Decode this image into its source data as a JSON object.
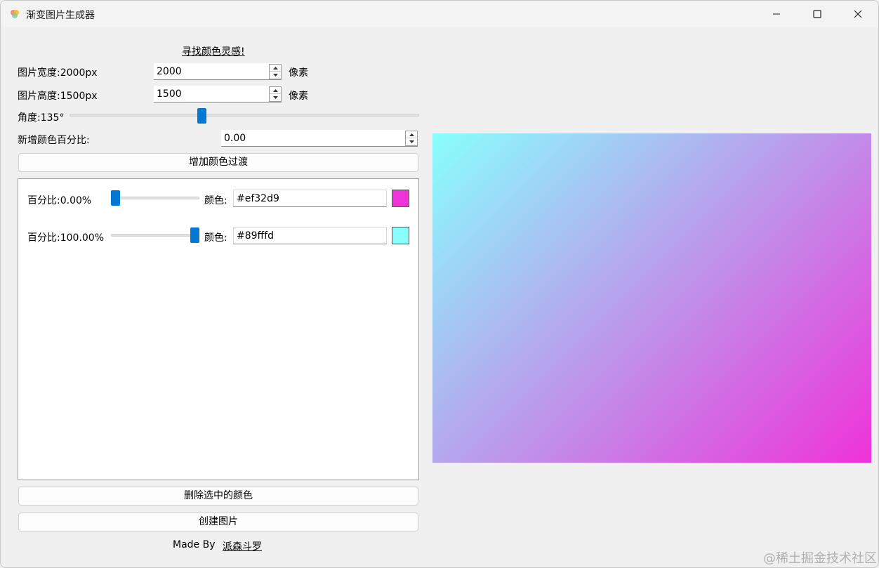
{
  "window": {
    "title": "渐变图片生成器"
  },
  "inspiration_link": "寻找颜色灵感!",
  "width": {
    "label": "图片宽度:2000px",
    "value": "2000",
    "unit": "像素"
  },
  "height": {
    "label": "图片高度:1500px",
    "value": "1500",
    "unit": "像素"
  },
  "angle": {
    "label": "角度:135°",
    "value_degrees": 135,
    "min": 0,
    "max": 360
  },
  "new_color_percent": {
    "label": "新增颜色百分比:",
    "value": "0.00"
  },
  "add_button": "增加颜色过渡",
  "color_stops": [
    {
      "label": "百分比:0.00%",
      "percent": 0.0,
      "color_label": "颜色:",
      "hex": "#ef32d9"
    },
    {
      "label": "百分比:100.00%",
      "percent": 100.0,
      "color_label": "颜色:",
      "hex": "#89fffd"
    }
  ],
  "delete_button": "删除选中的颜色",
  "create_button": "创建图片",
  "footer": {
    "made_by": "Made By",
    "author": "派森斗罗"
  },
  "watermark": "@稀土掘金技术社区",
  "colors": {
    "accent": "#0078d4",
    "gradient_start": "#ef32d9",
    "gradient_end": "#89fffd"
  }
}
